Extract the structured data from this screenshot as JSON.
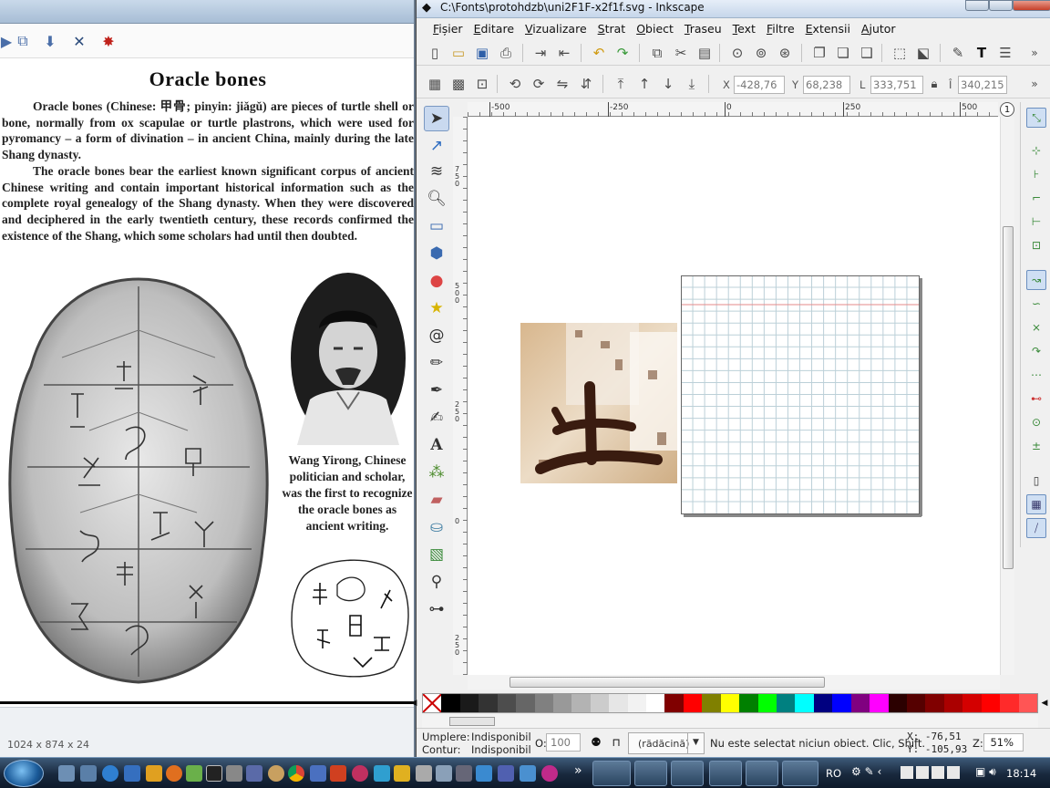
{
  "viewer": {
    "status_dims": "1024 x 874 x 24"
  },
  "document": {
    "title": "Oracle bones",
    "p1": "Oracle bones (Chinese: 甲骨; pinyin: jiǎgǔ) are pieces of turtle shell or bone, normally from ox scapulae or turtle plastrons, which were used for pyromancy – a form of divination – in ancient China, mainly during the late Shang dynasty.",
    "p2": "The oracle bones bear the earliest known significant corpus of ancient Chinese writing and contain important historical information such as the complete royal genealogy of the Shang dynasty. When they were discovered and deciphered in the early twentieth century, these records confirmed the existence of the Shang, which some scholars had until then doubted.",
    "caption": "Wang Yirong, Chinese politician and scholar, was the first to recognize the oracle bones as ancient writing."
  },
  "inkscape": {
    "title": "C:\\Fonts\\protohdzb\\uni2F1F-x2f1f.svg - Inkscape",
    "menu": [
      "Fișier",
      "Editare",
      "Vizualizare",
      "Strat",
      "Obiect",
      "Traseu",
      "Text",
      "Filtre",
      "Extensii",
      "Ajutor"
    ],
    "menu_underline": [
      "F",
      "E",
      "V",
      "S",
      "O",
      "T",
      "T",
      "F",
      "E",
      "A"
    ],
    "ctrl": {
      "x_label": "X",
      "x_value": "-428,76",
      "y_label": "Y",
      "y_value": "68,238",
      "w_label": "L",
      "w_value": "333,751",
      "h_label": "Î",
      "h_value": "340,215"
    },
    "ruler_h": [
      "-500",
      "-250",
      "0",
      "250",
      "500"
    ],
    "ruler_v": [
      "750",
      "500",
      "250",
      "0",
      "250"
    ],
    "status": {
      "fill_label": "Umplere:",
      "fill_value": "Indisponibil",
      "stroke_label": "Contur:",
      "stroke_value": "Indisponibil",
      "opacity_label": "O:",
      "opacity_value": "100",
      "layer": "(rădăcină)",
      "message": "Nu este selectat niciun obiect. Clic, Shift.",
      "cursor_x": "X: -76,51",
      "cursor_y": "Y: -105,93",
      "zoom_label": "Z:",
      "zoom_value": "51%"
    }
  },
  "palette": [
    "#000000",
    "#1a1a1a",
    "#333333",
    "#4d4d4d",
    "#666666",
    "#808080",
    "#999999",
    "#b3b3b3",
    "#cccccc",
    "#e6e6e6",
    "#f2f2f2",
    "#ffffff",
    "#800000",
    "#ff0000",
    "#808000",
    "#ffff00",
    "#008000",
    "#00ff00",
    "#008080",
    "#00ffff",
    "#000080",
    "#0000ff",
    "#800080",
    "#ff00ff",
    "#2b0000",
    "#550000",
    "#800000",
    "#aa0000",
    "#d40000",
    "#ff0000",
    "#ff2a2a",
    "#ff5555"
  ],
  "taskbar": {
    "lang": "RO",
    "clock": "18:14"
  }
}
